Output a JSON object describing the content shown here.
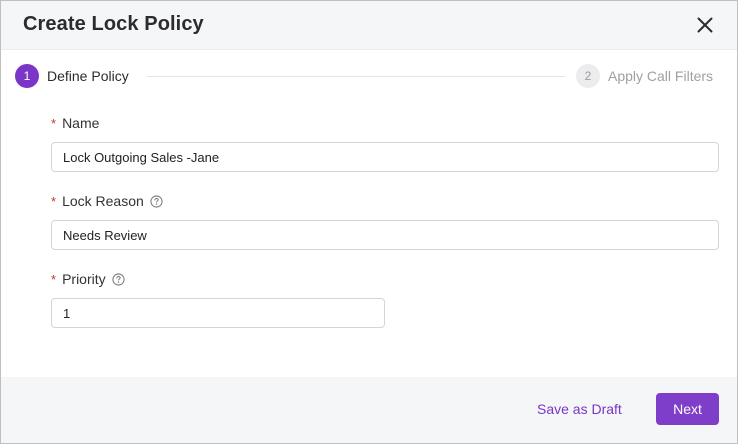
{
  "dialog": {
    "title": "Create Lock Policy",
    "close_icon": "close-icon"
  },
  "stepper": {
    "steps": [
      {
        "number": "1",
        "label": "Define Policy",
        "state": "active"
      },
      {
        "number": "2",
        "label": "Apply Call Filters",
        "state": "inactive"
      }
    ]
  },
  "form": {
    "name": {
      "label": "Name",
      "required_mark": "*",
      "value": "Lock Outgoing Sales -Jane"
    },
    "lock_reason": {
      "label": "Lock Reason",
      "required_mark": "*",
      "value": "Needs Review",
      "help_icon": "question-circle-icon"
    },
    "priority": {
      "label": "Priority",
      "required_mark": "*",
      "value": "1",
      "help_icon": "question-circle-icon"
    }
  },
  "footer": {
    "save_draft_label": "Save as Draft",
    "next_label": "Next"
  },
  "colors": {
    "accent": "#7b35c7",
    "required": "#c0392b",
    "header_bg": "#f5f6f8"
  }
}
